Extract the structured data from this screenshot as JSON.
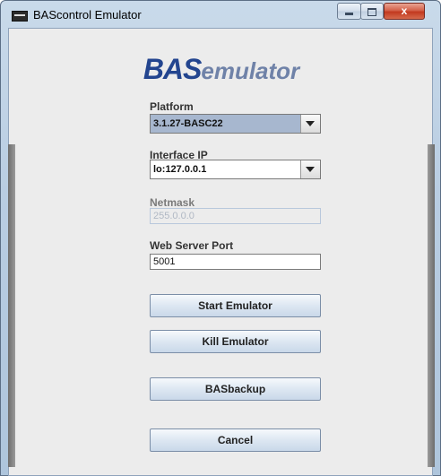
{
  "window": {
    "title": "BAScontrol Emulator",
    "close_glyph": "x"
  },
  "logo": {
    "bold": "BAS",
    "light": "emulator"
  },
  "form": {
    "platform": {
      "label": "Platform",
      "value": "3.1.27-BASC22"
    },
    "interface_ip": {
      "label": "Interface IP",
      "value": "lo:127.0.0.1"
    },
    "netmask": {
      "label": "Netmask",
      "value": "255.0.0.0"
    },
    "web_server_port": {
      "label": "Web Server Port",
      "value": "5001"
    }
  },
  "buttons": {
    "start": "Start Emulator",
    "kill": "Kill Emulator",
    "backup": "BASbackup",
    "cancel": "Cancel"
  },
  "colors": {
    "logo_primary": "#23458f",
    "logo_secondary": "#6f82a8",
    "window_frame": "#b9cde2",
    "close_button": "#c2391f"
  }
}
